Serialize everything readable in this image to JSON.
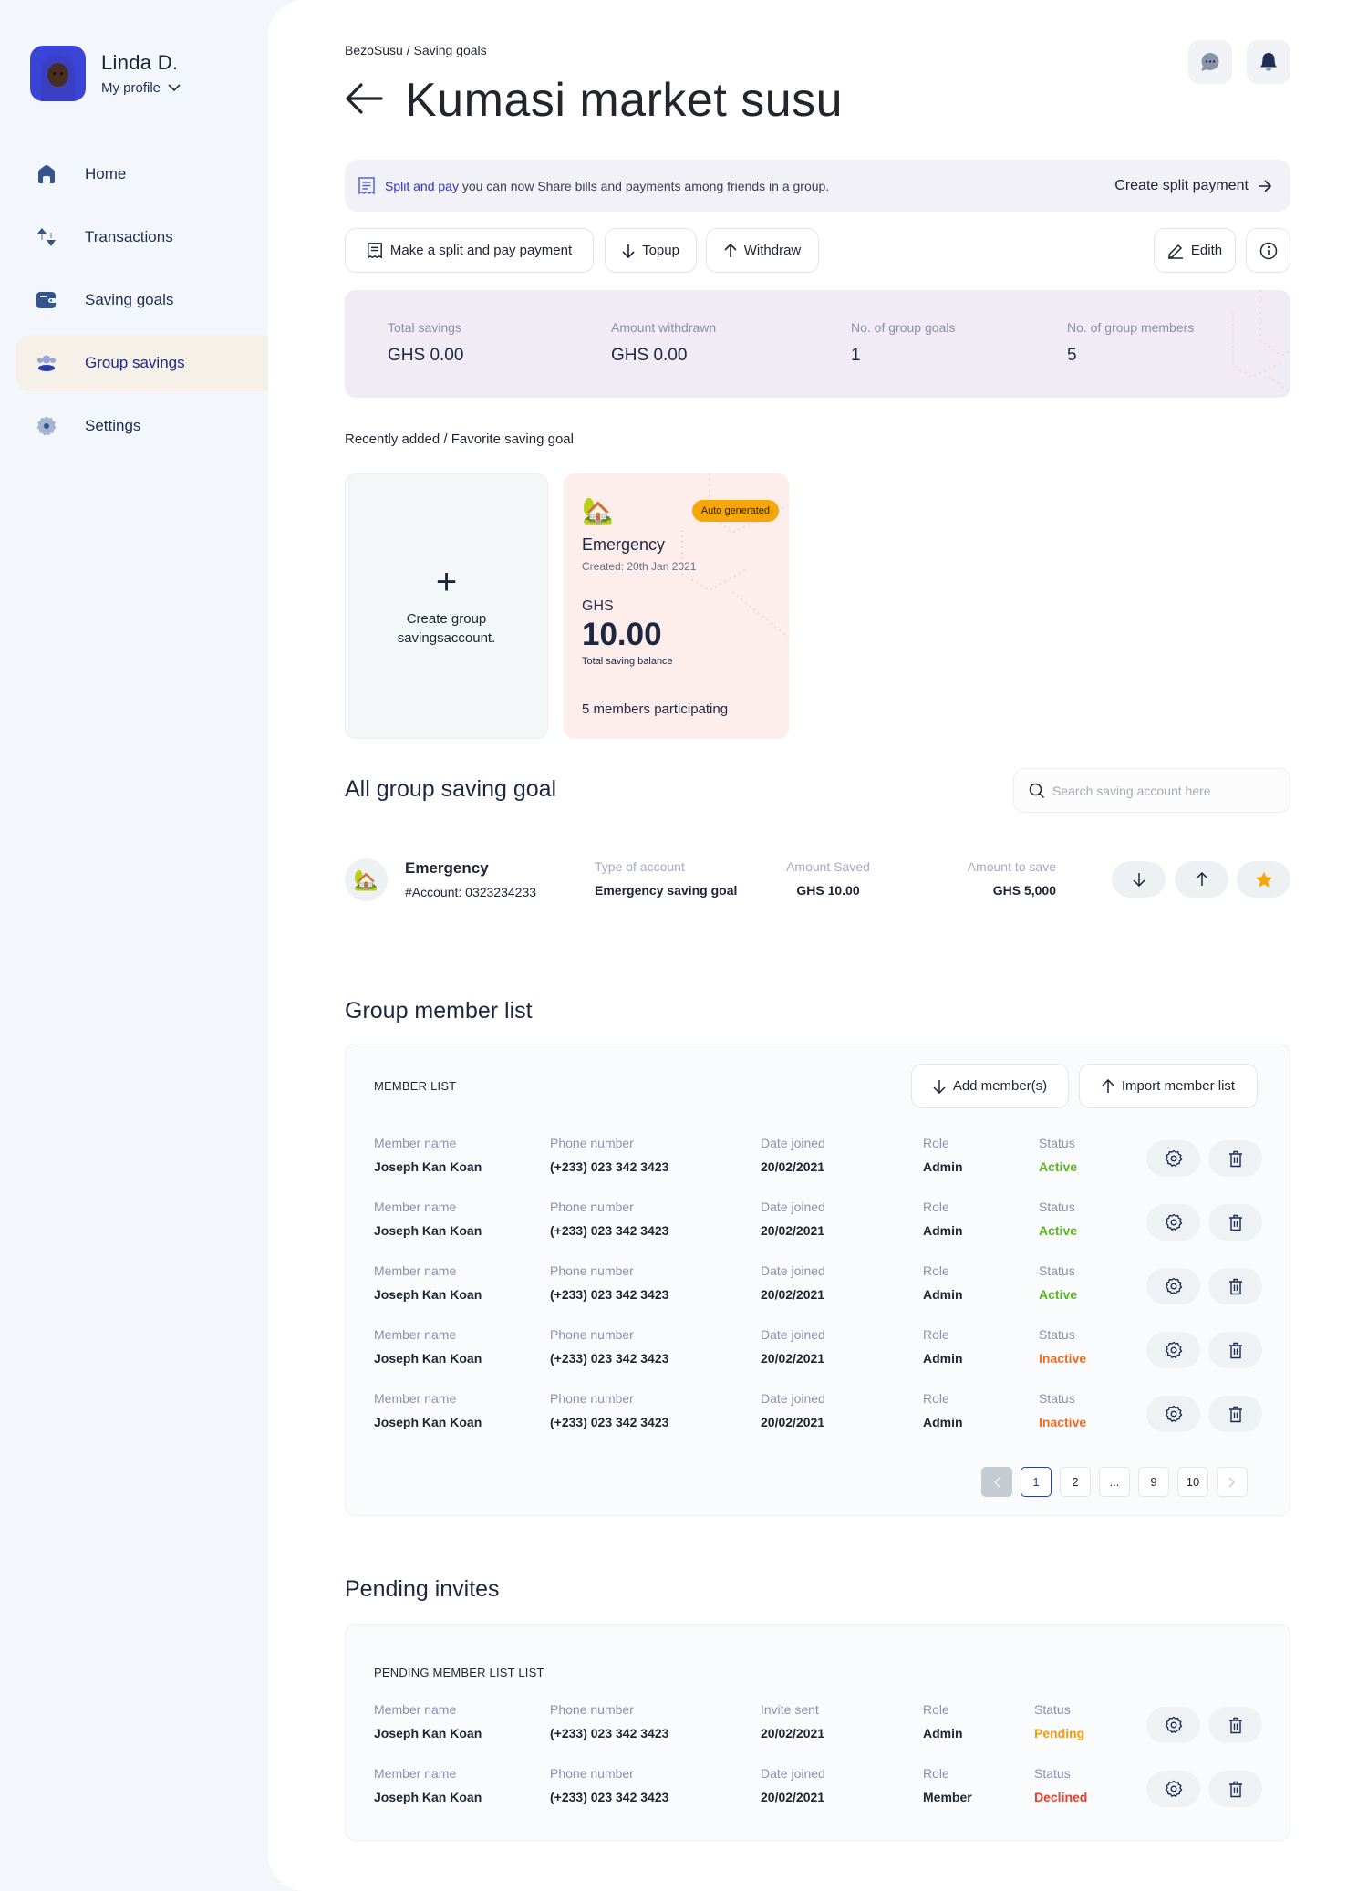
{
  "profile": {
    "name": "Linda D.",
    "link_label": "My profile"
  },
  "sidebar": {
    "items": [
      {
        "label": "Home",
        "icon": "home-icon",
        "active": false
      },
      {
        "label": "Transactions",
        "icon": "transactions-icon",
        "active": false
      },
      {
        "label": "Saving goals",
        "icon": "wallet-icon",
        "active": false
      },
      {
        "label": "Group savings",
        "icon": "group-icon",
        "active": true
      },
      {
        "label": "Settings",
        "icon": "settings-icon",
        "active": false
      }
    ]
  },
  "header": {
    "breadcrumb": "BezoSusu / Saving goals",
    "title": "Kumasi market susu"
  },
  "banner": {
    "highlight": "Split and pay",
    "text": " you can now Share bills and payments among friends in a group.",
    "cta": "Create split payment"
  },
  "actions": {
    "split_pay": "Make a split and pay payment",
    "topup": "Topup",
    "withdraw": "Withdraw",
    "edit": "Edith"
  },
  "stats": [
    {
      "label": "Total savings",
      "value": "GHS 0.00"
    },
    {
      "label": "Amount withdrawn",
      "value": "GHS 0.00"
    },
    {
      "label": "No. of group goals",
      "value": "1"
    },
    {
      "label": "No. of group members",
      "value": "5"
    }
  ],
  "recent": {
    "title": "Recently added / Favorite saving goal",
    "create_label": "Create group savingsaccount.",
    "goal": {
      "emoji": "🏡",
      "badge": "Auto generated",
      "name": "Emergency",
      "created": "Created: 20th Jan 2021",
      "currency": "GHS",
      "amount": "10.00",
      "amount_label": "Total saving balance",
      "members": "5 members participating"
    }
  },
  "all_goals": {
    "title": "All group saving goal",
    "search_placeholder": "Search saving account here",
    "rows": [
      {
        "emoji": "🏡",
        "name": "Emergency",
        "account": "#Account: 0323234233",
        "type_label": "Type of account",
        "type_value": "Emergency saving goal",
        "saved_label": "Amount Saved",
        "saved_value": "GHS 10.00",
        "target_label": "Amount to save",
        "target_value": "GHS 5,000"
      }
    ]
  },
  "members": {
    "title": "Group member list",
    "list_title": "MEMBER LIST",
    "add_label": "Add member(s)",
    "import_label": "Import member list",
    "labels": {
      "name": "Member name",
      "phone": "Phone number",
      "date": "Date  joined",
      "role": "Role",
      "status": "Status"
    },
    "rows": [
      {
        "name": "Joseph Kan Koan",
        "phone": "(+233) 023 342 3423",
        "date": "20/02/2021",
        "role": "Admin",
        "status": "Active"
      },
      {
        "name": "Joseph Kan Koan",
        "phone": "(+233) 023 342 3423",
        "date": "20/02/2021",
        "role": "Admin",
        "status": "Active"
      },
      {
        "name": "Joseph Kan Koan",
        "phone": "(+233) 023 342 3423",
        "date": "20/02/2021",
        "role": "Admin",
        "status": "Active"
      },
      {
        "name": "Joseph Kan Koan",
        "phone": "(+233) 023 342 3423",
        "date": "20/02/2021",
        "role": "Admin",
        "status": "Inactive"
      },
      {
        "name": "Joseph Kan Koan",
        "phone": "(+233) 023 342 3423",
        "date": "20/02/2021",
        "role": "Admin",
        "status": "Inactive"
      }
    ],
    "pagination": {
      "pages": [
        "1",
        "2",
        "...",
        "9",
        "10"
      ],
      "current": "1"
    }
  },
  "pending": {
    "title": "Pending invites",
    "list_title": "PENDING MEMBER LIST LIST",
    "rows": [
      {
        "name_label": "Member name",
        "name": "Joseph Kan Koan",
        "phone_label": "Phone number",
        "phone": "(+233) 023 342 3423",
        "date_label": "Invite sent",
        "date": "20/02/2021",
        "role_label": "Role",
        "role": "Admin",
        "status_label": "Status",
        "status": "Pending"
      },
      {
        "name_label": "Member name",
        "name": "Joseph Kan Koan",
        "phone_label": "Phone number",
        "phone": "(+233) 023 342 3423",
        "date_label": "Date  joined",
        "date": "20/02/2021",
        "role_label": "Role",
        "role": "Member",
        "status_label": "Status",
        "status": "Declined"
      }
    ]
  },
  "colors": {
    "accent": "#2E37B8",
    "active": "#5BB524",
    "inactive": "#F26B1D",
    "pending": "#F39C12",
    "declined": "#E8402A",
    "favorite": "#F6A609"
  }
}
